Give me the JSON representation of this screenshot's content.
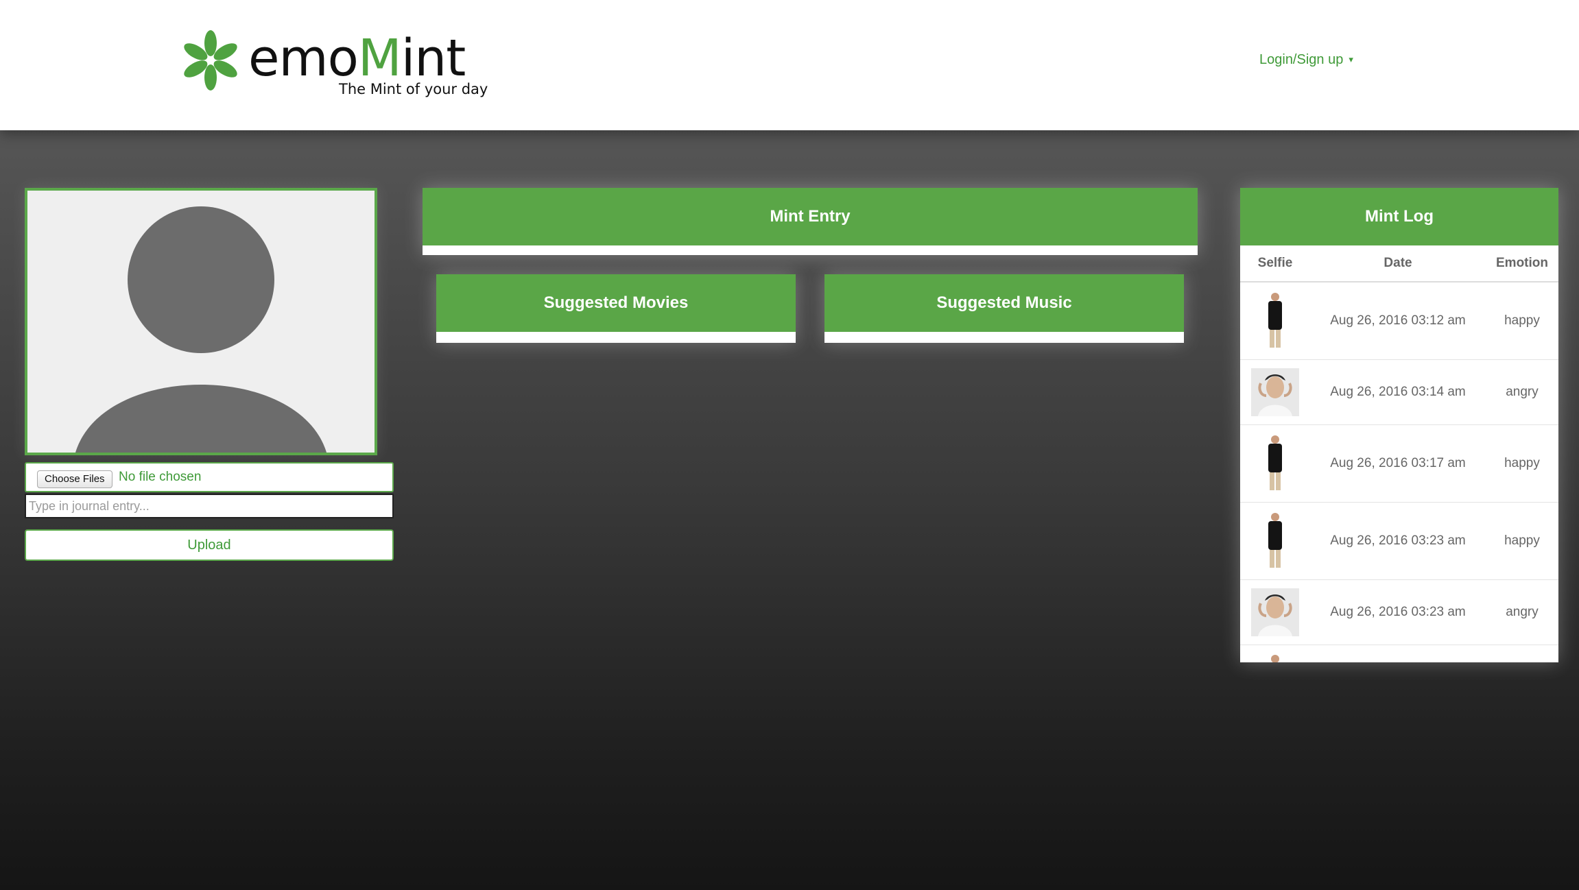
{
  "header": {
    "brand_prefix": "emo",
    "brand_accent": "M",
    "brand_suffix": "int",
    "tagline": "The Mint of your day",
    "login_label": "Login/Sign up",
    "login_caret": "▾"
  },
  "colors": {
    "brand_green": "#5aa647",
    "link_green": "#3f9a38",
    "background_top": "#5b5b5b",
    "background_bottom": "#151515"
  },
  "profile": {
    "placeholder_icon": "user-silhouette-icon",
    "choose_files_label": "Choose Files",
    "file_status": "No file chosen",
    "journal_placeholder": "Type in journal entry...",
    "upload_label": "Upload"
  },
  "panels": {
    "mint_entry_title": "Mint Entry",
    "suggested_movies_title": "Suggested Movies",
    "suggested_music_title": "Suggested Music"
  },
  "mint_log": {
    "title": "Mint Log",
    "columns": [
      "Selfie",
      "Date",
      "Emotion"
    ],
    "rows": [
      {
        "selfie_icon": "standing-person-photo",
        "date": "Aug 26, 2016 03:12 am",
        "emotion": "happy"
      },
      {
        "selfie_icon": "face-portrait-photo",
        "date": "Aug 26, 2016 03:14 am",
        "emotion": "angry"
      },
      {
        "selfie_icon": "standing-person-photo",
        "date": "Aug 26, 2016 03:17 am",
        "emotion": "happy"
      },
      {
        "selfie_icon": "standing-person-photo",
        "date": "Aug 26, 2016 03:23 am",
        "emotion": "happy"
      },
      {
        "selfie_icon": "face-portrait-photo",
        "date": "Aug 26, 2016 03:23 am",
        "emotion": "angry"
      }
    ]
  }
}
